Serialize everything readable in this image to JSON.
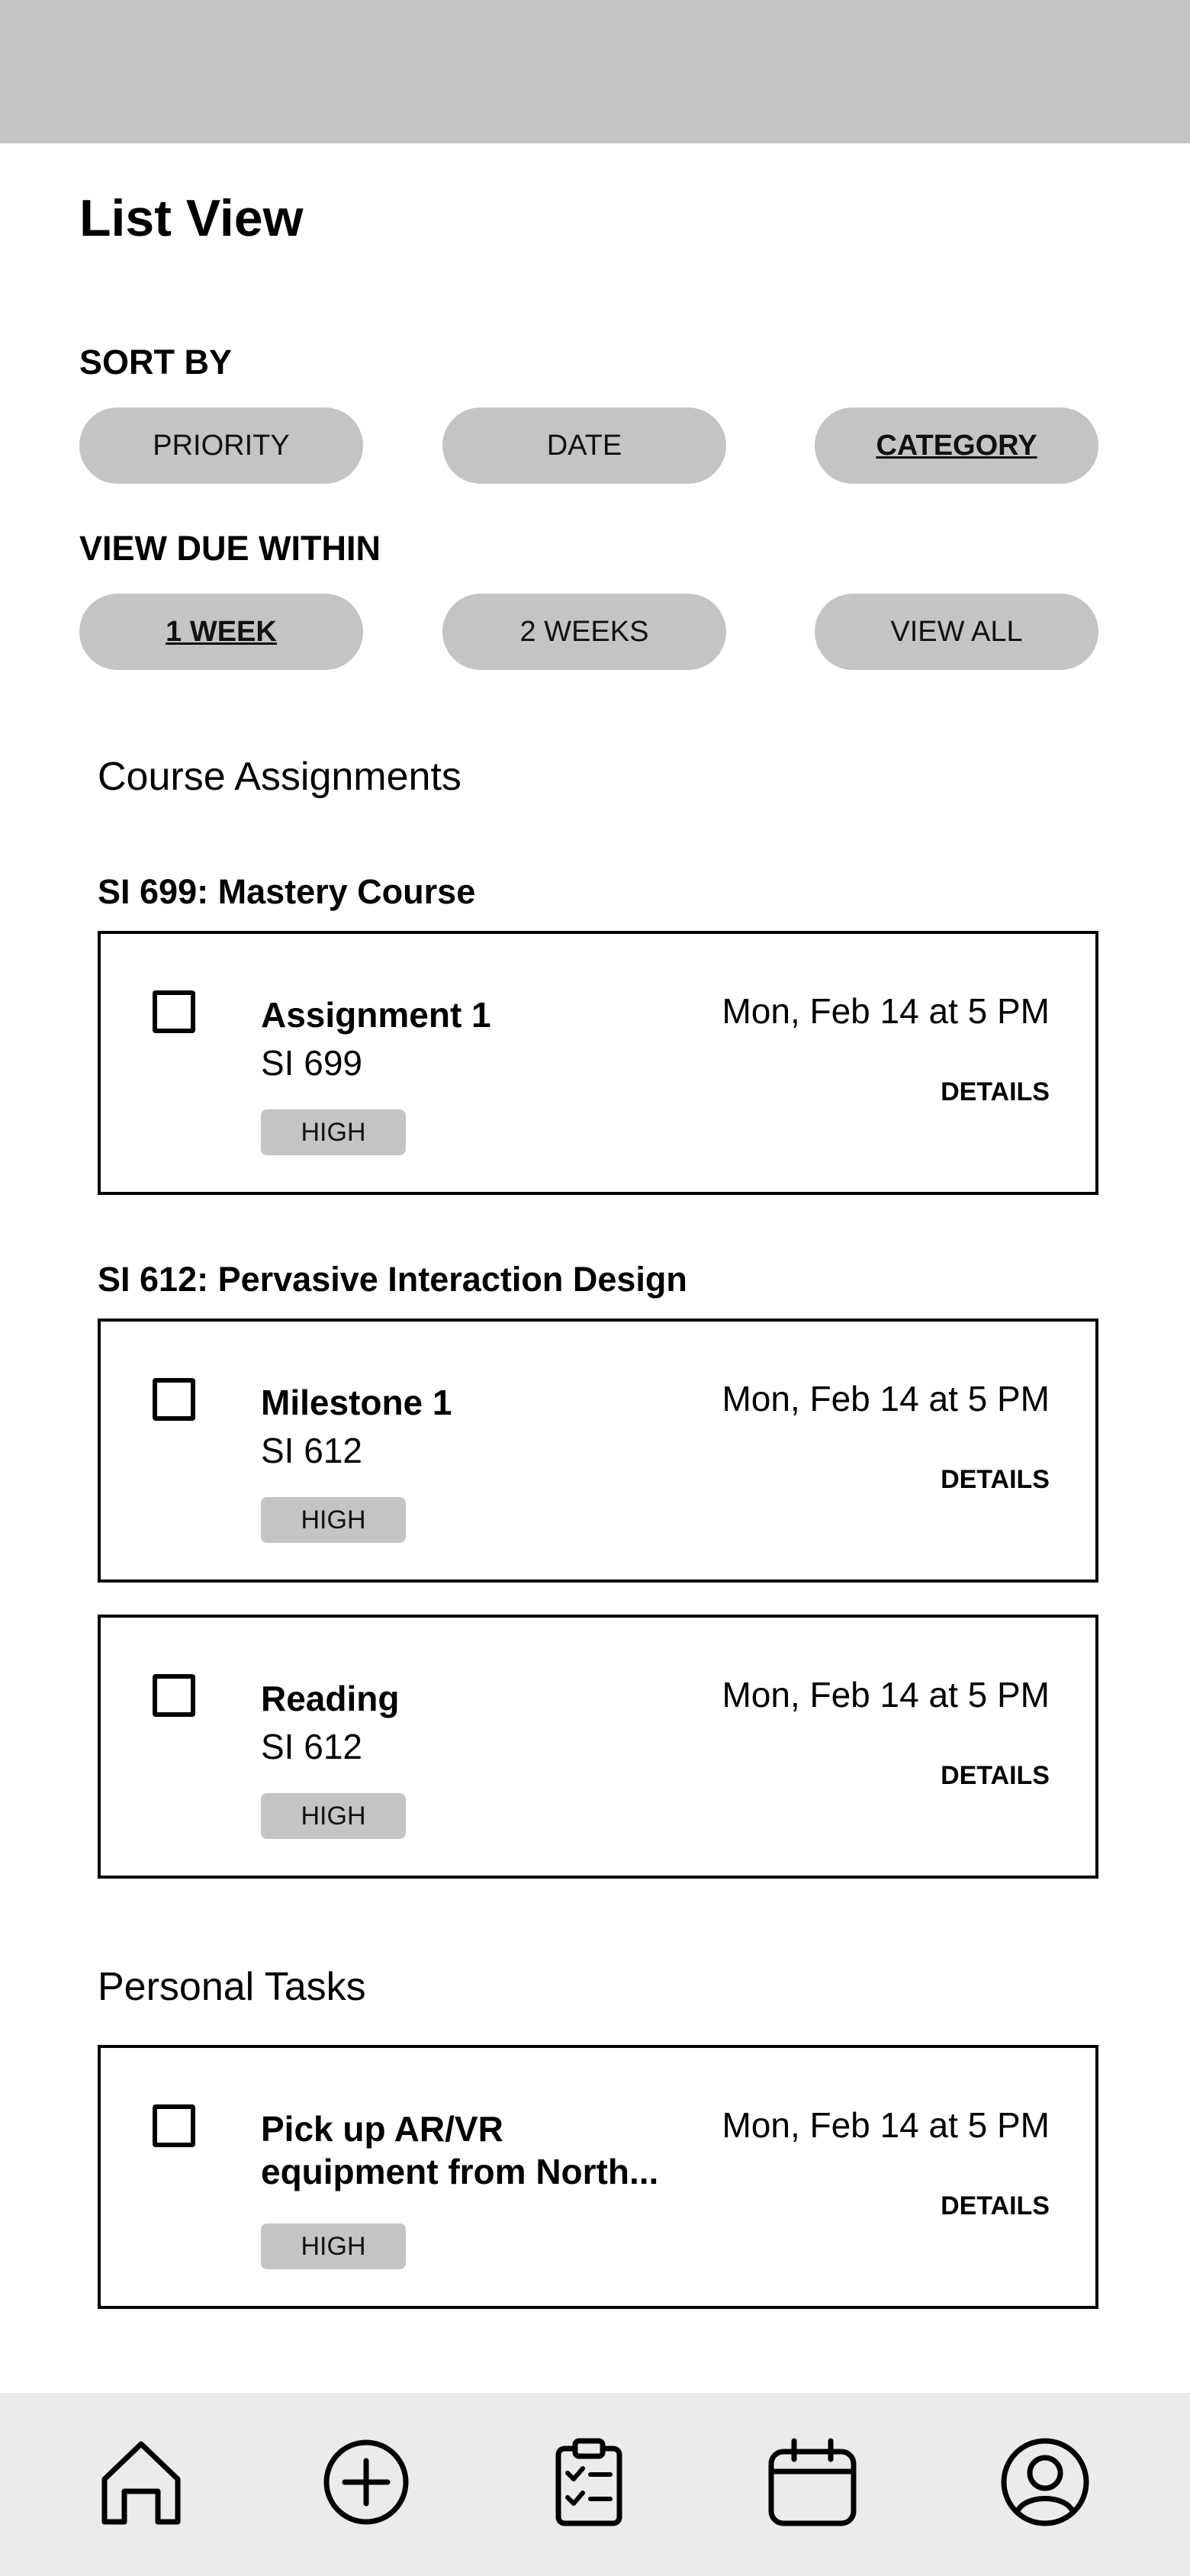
{
  "page": {
    "title": "List View"
  },
  "sort": {
    "label": "SORT BY",
    "options": [
      "PRIORITY",
      "DATE",
      "CATEGORY"
    ],
    "active": "CATEGORY"
  },
  "due_filter": {
    "label": "VIEW DUE WITHIN",
    "options": [
      "1 WEEK",
      "2 WEEKS",
      "VIEW ALL"
    ],
    "active": "1 WEEK"
  },
  "course_assignments": {
    "heading": "Course Assignments",
    "courses": [
      {
        "name": "SI 699: Mastery Course",
        "tasks": [
          {
            "title": "Assignment 1",
            "course": "SI 699",
            "priority": "HIGH",
            "due": "Mon, Feb 14 at 5 PM",
            "details": "DETAILS"
          }
        ]
      },
      {
        "name": "SI 612: Pervasive Interaction Design",
        "tasks": [
          {
            "title": "Milestone 1",
            "course": "SI 612",
            "priority": "HIGH",
            "due": "Mon, Feb 14 at 5 PM",
            "details": "DETAILS"
          },
          {
            "title": "Reading",
            "course": "SI 612",
            "priority": "HIGH",
            "due": "Mon, Feb 14 at 5 PM",
            "details": "DETAILS"
          }
        ]
      }
    ]
  },
  "personal_tasks": {
    "heading": "Personal Tasks",
    "tasks": [
      {
        "title": "Pick up AR/VR equipment from North...",
        "priority": "HIGH",
        "due": "Mon, Feb 14 at 5 PM",
        "details": "DETAILS"
      }
    ]
  },
  "nav": {
    "items": [
      {
        "icon": "home-icon"
      },
      {
        "icon": "add-circle-icon"
      },
      {
        "icon": "clipboard-checklist-icon"
      },
      {
        "icon": "calendar-icon"
      },
      {
        "icon": "user-profile-icon"
      }
    ]
  }
}
